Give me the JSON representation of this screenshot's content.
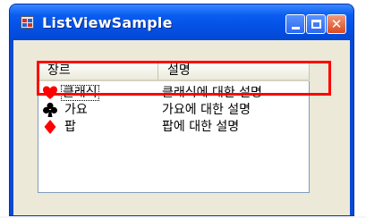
{
  "window": {
    "title": "ListViewSample",
    "icon": "app-window-icon"
  },
  "titlebar_buttons": {
    "minimize": "minimize-icon",
    "maximize": "maximize-icon",
    "close": "close-icon"
  },
  "listview": {
    "columns": [
      "장르",
      "설명"
    ],
    "rows": [
      {
        "icon": "heart-icon",
        "color": "#ff0000",
        "name": "클래식",
        "desc": "클래식에 대한 설명"
      },
      {
        "icon": "club-icon",
        "color": "#000000",
        "name": "가요",
        "desc": "가요에 대한 설명"
      },
      {
        "icon": "diamond-icon",
        "color": "#ff0000",
        "name": "팝",
        "desc": "팝에 대한 설명"
      }
    ]
  },
  "colors": {
    "titlebar": "#0452e6",
    "client": "#ece9d8",
    "highlight": "#ff0000"
  }
}
